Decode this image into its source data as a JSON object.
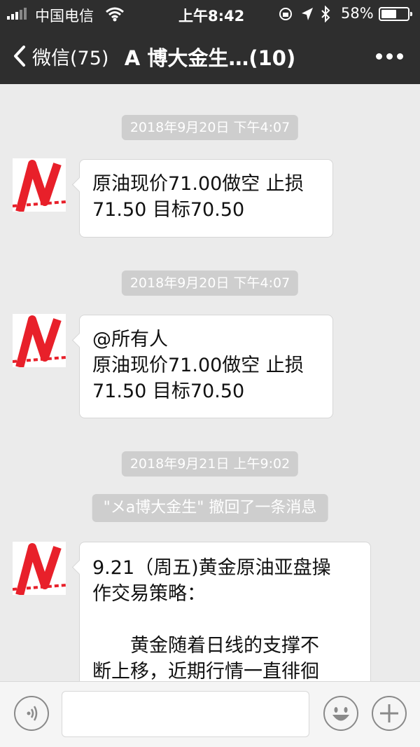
{
  "status_bar": {
    "carrier": "中国电信",
    "time": "上午8:42",
    "battery_pct": "58%",
    "battery_level": 0.58,
    "icons": [
      "signal-icon",
      "wifi-icon",
      "rotation-lock-icon",
      "location-icon",
      "bluetooth-icon",
      "battery-icon"
    ]
  },
  "nav": {
    "back_label": "微信(75)",
    "title": "A 博大金生…(10)",
    "more_icon": "more-icon"
  },
  "messages": [
    {
      "type": "timestamp",
      "text": "2018年9月20日 下午4:07"
    },
    {
      "type": "text",
      "lines": [
        "原油现价71.00做空 止损",
        "71.50 目标70.50"
      ]
    },
    {
      "type": "timestamp",
      "text": "2018年9月20日 下午4:07"
    },
    {
      "type": "text",
      "lines": [
        "@所有人",
        "原油现价71.00做空 止损",
        "71.50 目标70.50"
      ]
    },
    {
      "type": "timestamp",
      "text": "2018年9月21日 上午9:02"
    },
    {
      "type": "system",
      "text": "\"メa博大金生\" 撤回了一条消息"
    },
    {
      "type": "text",
      "lines": [
        "9.21（周五)黄金原油亚盘操",
        "作交易策略：",
        "",
        "　　黄金随着日线的支撑不",
        "断上移，近期行情一直徘徊"
      ]
    }
  ],
  "input_bar": {
    "voice_icon": "voice-icon",
    "emoji_icon": "emoji-icon",
    "plus_icon": "plus-icon"
  },
  "colors": {
    "nav_bg": "#2e2e2e",
    "chat_bg": "#ebebeb",
    "timestamp_bg": "#cecece",
    "avatar_red": "#e8202a"
  }
}
